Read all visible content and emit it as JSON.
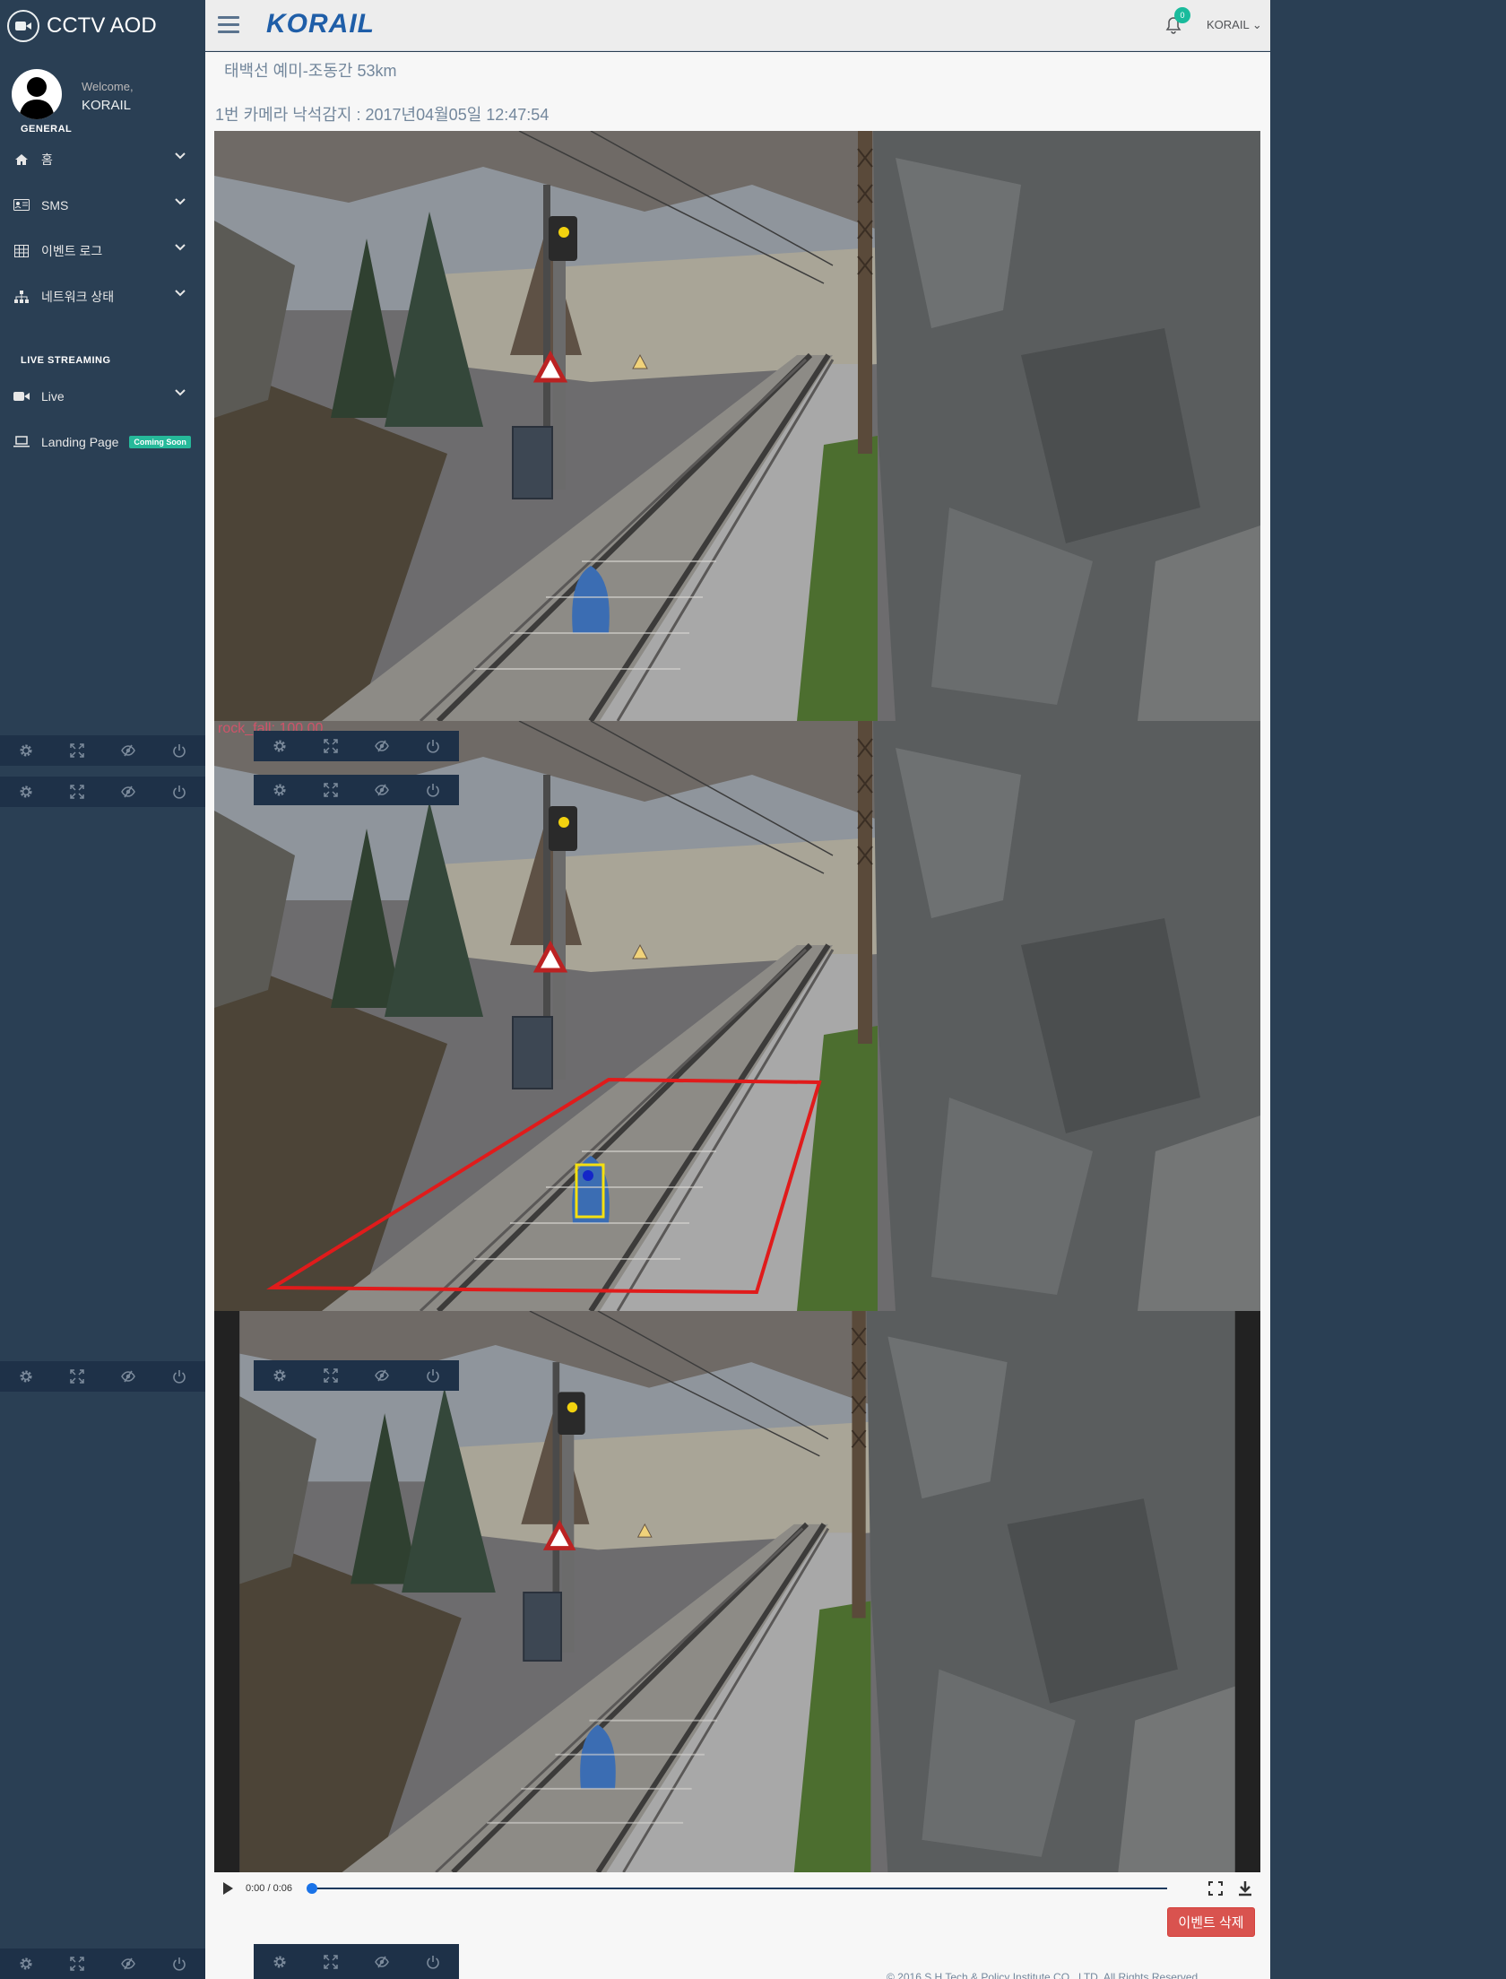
{
  "app": {
    "title": "CCTV AOD"
  },
  "profile": {
    "welcome": "Welcome,",
    "name": "KORAIL"
  },
  "sidebar": {
    "general_label": "GENERAL",
    "items": [
      {
        "label": "홈",
        "icon": "home-icon"
      },
      {
        "label": "SMS",
        "icon": "id-card-icon"
      },
      {
        "label": "이벤트 로그",
        "icon": "table-icon"
      },
      {
        "label": "네트워크 상태",
        "icon": "sitemap-icon"
      }
    ],
    "live_label": "LIVE STREAMING",
    "live_items": [
      {
        "label": "Live",
        "icon": "video-icon"
      },
      {
        "label": "Landing Page",
        "icon": "laptop-icon",
        "badge": "Coming Soon"
      }
    ]
  },
  "topnav": {
    "logo": "KORAIL",
    "notification_count": "0",
    "user_menu": "KORAIL"
  },
  "content": {
    "route_title": "태백선 예미-조동간 53km",
    "event_title": "1번 카메라 낙석감지 : 2017년04월05일 12:47:54",
    "overlay_text": "rock_fall: 100.00"
  },
  "video": {
    "time": "0:00 / 0:06",
    "progress": 0
  },
  "buttons": {
    "delete": "이벤트 삭제"
  },
  "footer": {
    "text": "© 2016 S.H Tech & Policy Institute CO., LTD. All Rights Reserved."
  },
  "colors": {
    "sidebar": "#2a3f54",
    "toolbar": "#1e3148",
    "danger": "#d9534f",
    "accent": "#1abb9c"
  }
}
